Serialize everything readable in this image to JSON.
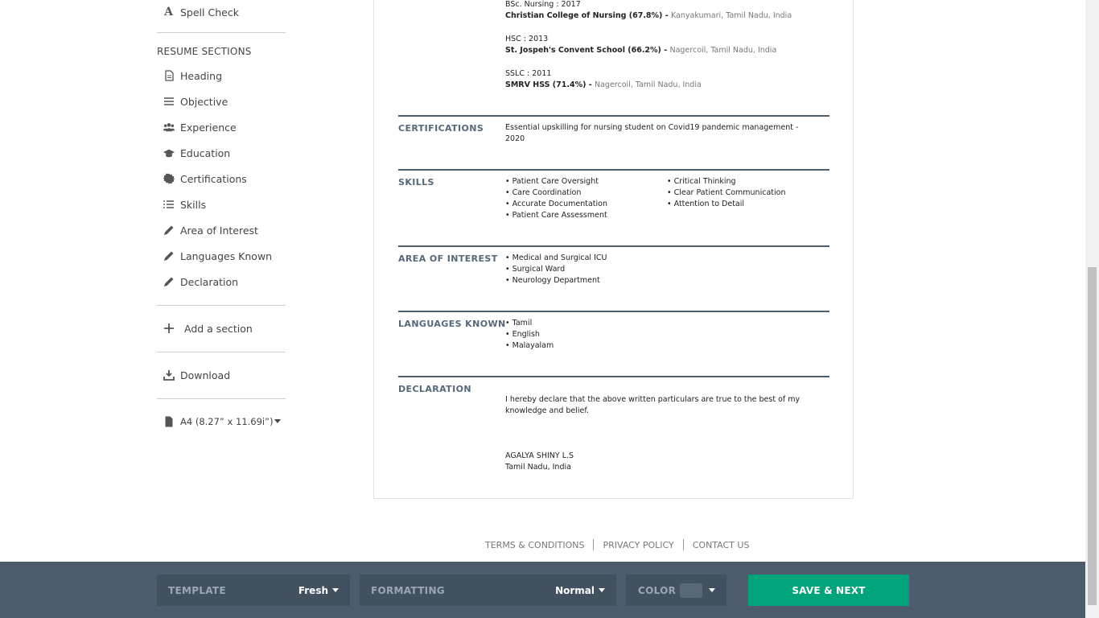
{
  "sidebar": {
    "spell_check": "Spell Check",
    "sections_heading": "RESUME SECTIONS",
    "items": [
      {
        "label": "Heading",
        "icon": "document-icon"
      },
      {
        "label": "Objective",
        "icon": "lines-icon"
      },
      {
        "label": "Experience",
        "icon": "users-icon"
      },
      {
        "label": "Education",
        "icon": "graduation-cap-icon"
      },
      {
        "label": "Certifications",
        "icon": "certificate-icon"
      },
      {
        "label": "Skills",
        "icon": "list-icon"
      },
      {
        "label": "Area of Interest",
        "icon": "pencil-icon"
      },
      {
        "label": "Languages Known",
        "icon": "pencil-icon"
      },
      {
        "label": "Declaration",
        "icon": "pencil-icon"
      }
    ],
    "add_section": "Add a section",
    "download": "Download",
    "page_size": "A4 (8.27” x 11.69i”)"
  },
  "resume": {
    "education": [
      {
        "degree": "BSc. Nursing : 2017",
        "school": "Christian College of Nursing (67.8%)",
        "location": "Kanyakumari, Tamil Nadu, India"
      },
      {
        "degree": "HSC : 2013",
        "school": "St. Jospeh's Convent School (66.2%)",
        "location": "Nagercoil, Tamil Nadu, India"
      },
      {
        "degree": "SSLC : 2011",
        "school": "SMRV HSS (71.4%)",
        "location": "Nagercoil, Tamil Nadu, India"
      }
    ],
    "sep": " - ",
    "certifications": {
      "title": "CERTIFICATIONS",
      "text": "Essential upskilling for nursing student on Covid19 pandemic management - 2020"
    },
    "skills": {
      "title": "SKILLS",
      "col1": [
        "• Patient Care Oversight",
        "• Care Coordination",
        "• Accurate Documentation",
        "• Patient Care Assessment"
      ],
      "col2": [
        "• Critical Thinking",
        "• Clear Patient Communication",
        "• Attention to Detail"
      ]
    },
    "interest": {
      "title": "AREA OF INTEREST",
      "items": [
        "• Medical and Surgical ICU",
        "• Surgical Ward",
        "• Neurology Department"
      ]
    },
    "languages": {
      "title": "LANGUAGES KNOWN",
      "items": [
        "• Tamil",
        "• English",
        "• Malayalam"
      ]
    },
    "declaration": {
      "title": "DECLARATION",
      "text": "I hereby declare that the above written particulars are true to the best of my knowledge and belief.",
      "name": "AGALYA SHINY L.S",
      "place": "Tamil Nadu, India"
    }
  },
  "footer": {
    "terms": "TERMS & CONDITIONS",
    "privacy": "PRIVACY POLICY",
    "contact": "CONTACT US"
  },
  "bottom_bar": {
    "template_label": "TEMPLATE",
    "template_value": "Fresh",
    "formatting_label": "FORMATTING",
    "formatting_value": "Normal",
    "color_label": "COLOR",
    "save": "SAVE & NEXT",
    "save_color": "#00a47a",
    "bar_color": "#4c5c6d"
  }
}
